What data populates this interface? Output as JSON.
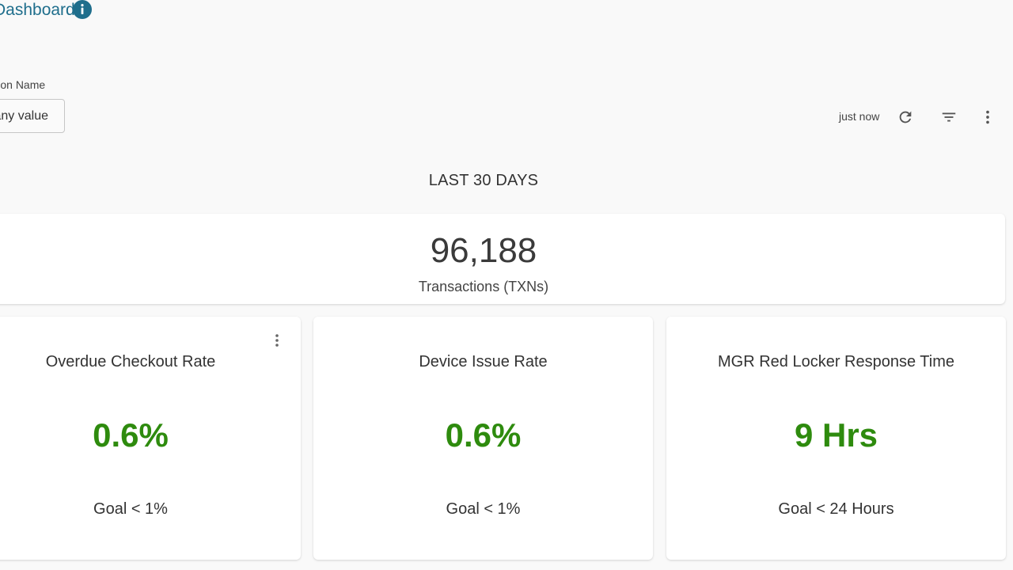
{
  "header": {
    "title": "Dashboard",
    "info_icon": "info-icon"
  },
  "filter": {
    "label": "Location Name",
    "value": "is any value"
  },
  "toolbar": {
    "updated": "just now",
    "refresh_icon": "refresh-icon",
    "filter_icon": "filter-icon",
    "more_icon": "more-vertical-icon"
  },
  "section": {
    "title": "LAST 30 DAYS"
  },
  "total": {
    "value": "96,188",
    "label": "Transactions (TXNs)"
  },
  "metrics": [
    {
      "title": "Overdue Checkout Rate",
      "value": "0.6%",
      "goal": "Goal < 1%"
    },
    {
      "title": "Device Issue Rate",
      "value": "0.6%",
      "goal": "Goal < 1%"
    },
    {
      "title": "MGR Red Locker Response Time",
      "value": "9 Hrs",
      "goal": "Goal < 24 Hours"
    }
  ],
  "colors": {
    "title": "#1f6e8c",
    "metric_value": "#2e8b0e",
    "background": "#f9f9f9"
  }
}
